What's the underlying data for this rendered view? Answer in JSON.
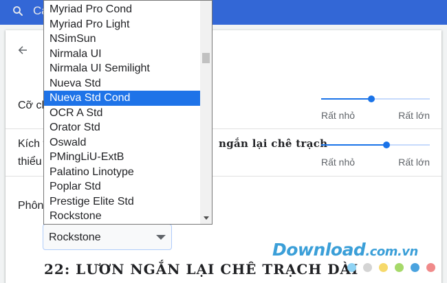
{
  "search": {
    "prefix": "Ca"
  },
  "rows": {
    "font_size_label": "Cỡ ch",
    "min_size_label_1": "Kích t",
    "min_size_label_2": "thiểu",
    "font_label": "Phôn"
  },
  "sliders": {
    "font_size": {
      "min_label": "Rất nhỏ",
      "max_label": "Rất lớn",
      "value_fraction": 0.46
    },
    "min_font_size": {
      "min_label": "Rất nhỏ",
      "max_label": "Rất lớn",
      "value_fraction": 0.6
    }
  },
  "preview_sample": "ngắn lại chê trạch",
  "select": {
    "value": "Rockstone"
  },
  "big_preview": "22: LƯƠN NGẮN LẠI CHÊ TRẠCH DÀI",
  "watermark": {
    "text": "Download",
    "domain": ".com.vn"
  },
  "watermark_dot_colors": [
    "#8fd3f4",
    "#d4d4d4",
    "#f6d96b",
    "#a6d96a",
    "#4aa3df",
    "#f08a8a"
  ],
  "dropdown": {
    "selected_index": 6,
    "options": [
      "Myriad Pro Cond",
      "Myriad Pro Light",
      "NSimSun",
      "Nirmala UI",
      "Nirmala UI Semilight",
      "Nueva Std",
      "Nueva Std Cond",
      "OCR A Std",
      "Orator Std",
      "Oswald",
      "PMingLiU-ExtB",
      "Palatino Linotype",
      "Poplar Std",
      "Prestige Elite Std",
      "Rockstone"
    ]
  },
  "colors": {
    "header": "#3367d6",
    "accent": "#1a73e8",
    "selection": "#1e73e8"
  }
}
